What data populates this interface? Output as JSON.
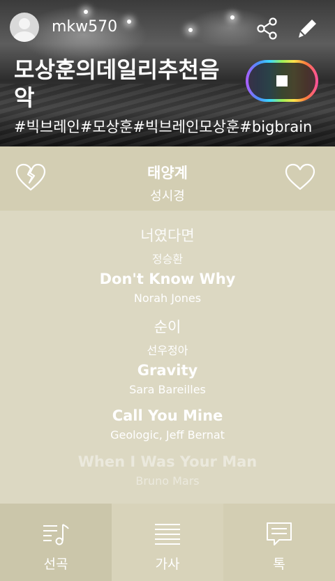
{
  "header": {
    "username": "mkw570",
    "playlist_title": "모상훈의데일리추천음악",
    "hashtags": "#빅브레인#모상훈#빅브레인모상훈#bigbrain",
    "playback_state": "playing"
  },
  "now_playing": {
    "title": "태양계",
    "artist": "성시경"
  },
  "queue": [
    {
      "title": "너였다면",
      "artist": "정승환"
    },
    {
      "title": "Don't Know Why",
      "artist": "Norah Jones"
    },
    {
      "title": "순이",
      "artist": "선우정아"
    },
    {
      "title": "Gravity",
      "artist": "Sara Bareilles"
    },
    {
      "title": "Call You Mine",
      "artist": "Geologic, Jeff Bernat"
    },
    {
      "title": "When I Was Your Man",
      "artist": "Bruno Mars"
    }
  ],
  "bottom_nav": [
    {
      "label": "선곡",
      "icon": "music-list-icon",
      "active": true
    },
    {
      "label": "가사",
      "icon": "lyrics-icon",
      "active": false
    },
    {
      "label": "톡",
      "icon": "chat-icon",
      "active": false
    }
  ],
  "colors": {
    "background": "#d6d1b8",
    "text": "#ffffff"
  }
}
